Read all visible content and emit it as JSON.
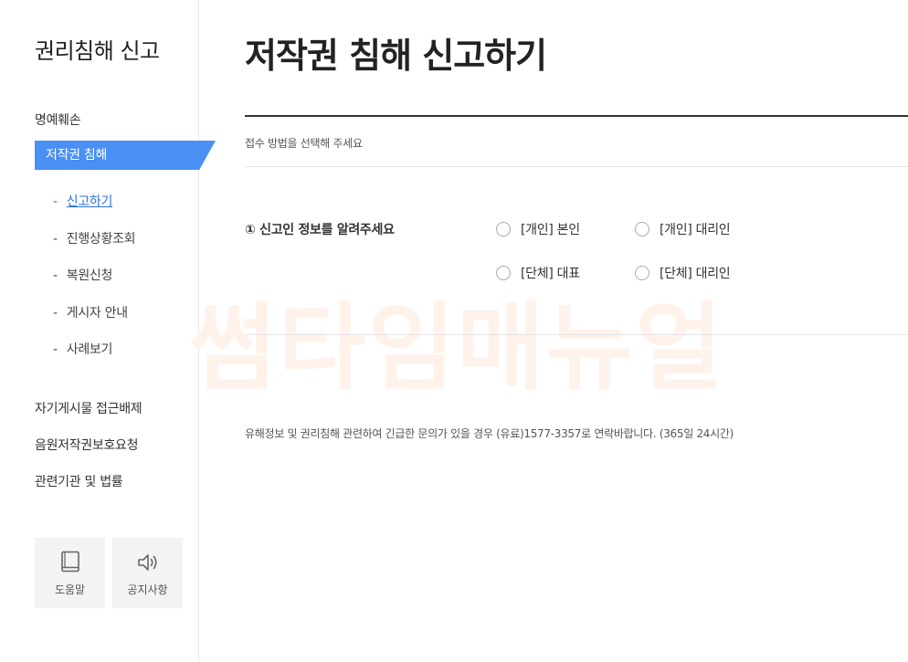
{
  "sidebar": {
    "title": "권리침해 신고",
    "menu": {
      "defamation": "명예훼손",
      "copyright": "저작권 침해",
      "self_post_block": "자기게시물 접근배제",
      "music_copyright": "음원저작권보호요청",
      "related_orgs": "관련기관 및 법률"
    },
    "submenu": [
      {
        "label": "신고하기",
        "active": true
      },
      {
        "label": "진행상황조회",
        "active": false
      },
      {
        "label": "복원신청",
        "active": false
      },
      {
        "label": "게시자 안내",
        "active": false
      },
      {
        "label": "사례보기",
        "active": false
      }
    ],
    "submenu_dash": "-",
    "tools": {
      "help": {
        "label": "도움말",
        "icon": "book-icon"
      },
      "notice": {
        "label": "공지사항",
        "icon": "speaker-icon"
      }
    }
  },
  "main": {
    "title": "저작권 침해 신고하기",
    "intro": "접수 방법을 선택해 주세요",
    "question": "① 신고인 정보를 알려주세요",
    "options": {
      "individual_self": "[개인] 본인",
      "individual_agent": "[개인] 대리인",
      "group_rep": "[단체] 대표",
      "group_agent": "[단체] 대리인"
    },
    "notice": "유해정보 및 권리침해 관련하여 긴급한 문의가 있을 경우 (유료)1577-3357로 연락바랍니다. (365일 24시간)"
  },
  "watermark": "썸타임매뉴얼",
  "colors": {
    "accent": "#4a8ff3",
    "active_link": "#2f73e6",
    "watermark": "#fff2ea"
  }
}
